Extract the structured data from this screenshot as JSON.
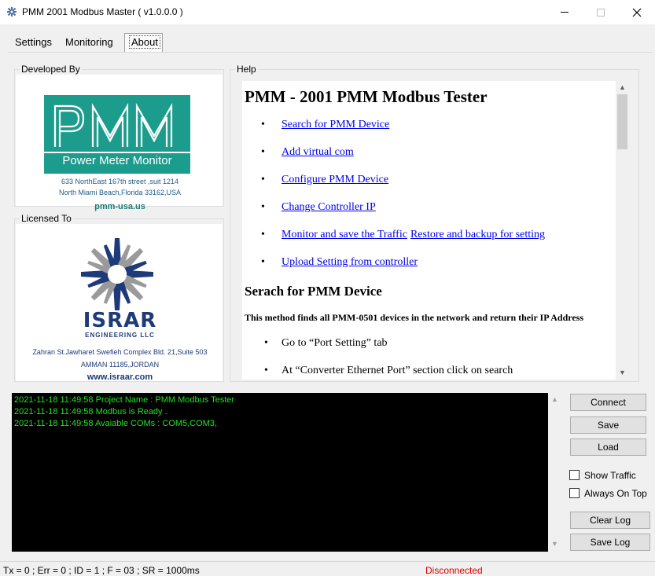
{
  "window": {
    "title": "PMM 2001 Modbus Master ( v1.0.0.0 )"
  },
  "tabs": [
    {
      "label": "Settings"
    },
    {
      "label": "Monitoring"
    },
    {
      "label": "About"
    }
  ],
  "developed_by": {
    "label": "Developed By",
    "logo_text": "PMM",
    "logo_tagline": "Power Meter Monitor",
    "address_line1": "633 NorthEast 167th street ,suit 1214",
    "address_line2": "North Miami Beach,Florida 33162,USA",
    "website": "pmm-usa.us"
  },
  "licensed_to": {
    "label": "Licensed To",
    "logo_name": "ISRAR",
    "logo_sub": "ENGINEERING LLC",
    "address_line1": "Zahran St.Jawharet Swefieh  Complex Bld. 21,Suite 503",
    "address_line2": "AMMAN 11185,JORDAN",
    "website": "www.israar.com"
  },
  "help": {
    "label": "Help",
    "heading": "PMM - 2001 PMM Modbus Tester",
    "links": [
      "Search for PMM Device",
      "Add virtual com",
      "Configure PMM Device",
      "Change Controller IP",
      "Monitor and save the Traffic",
      "Upload Setting from controller"
    ],
    "extra_link": "Restore and backup for setting",
    "section_heading": "Serach for PMM Device",
    "section_intro": "This method finds all PMM-0501 devices in the network and return their IP Address",
    "steps": [
      "Go to “Port Setting” tab",
      "At “Converter Ethernet Port” section click on search"
    ]
  },
  "log": {
    "lines": [
      "2021-11-18 11:49:58 Project Name : PMM Modbus Tester",
      "2021-11-18 11:49:58 Modbus is Ready .",
      "2021-11-18 11:49:58 Avaiable COMs : COM5,COM3,"
    ]
  },
  "buttons": {
    "connect": "Connect",
    "save": "Save",
    "load": "Load",
    "clear_log": "Clear Log",
    "save_log": "Save Log"
  },
  "options": {
    "show_traffic": {
      "label": "Show Traffic",
      "checked": false
    },
    "always_on_top": {
      "label": "Always On Top",
      "checked": false
    }
  },
  "status": {
    "stats": "Tx = 0 ; Err = 0 ; ID = 1 ; F = 03 ; SR = 1000ms",
    "connection": "Disconnected",
    "connection_color": "#e00000"
  },
  "colors": {
    "pmm_brand": "#1b9c8d",
    "israr_brand": "#1e3a78",
    "log_text": "#22e022"
  }
}
